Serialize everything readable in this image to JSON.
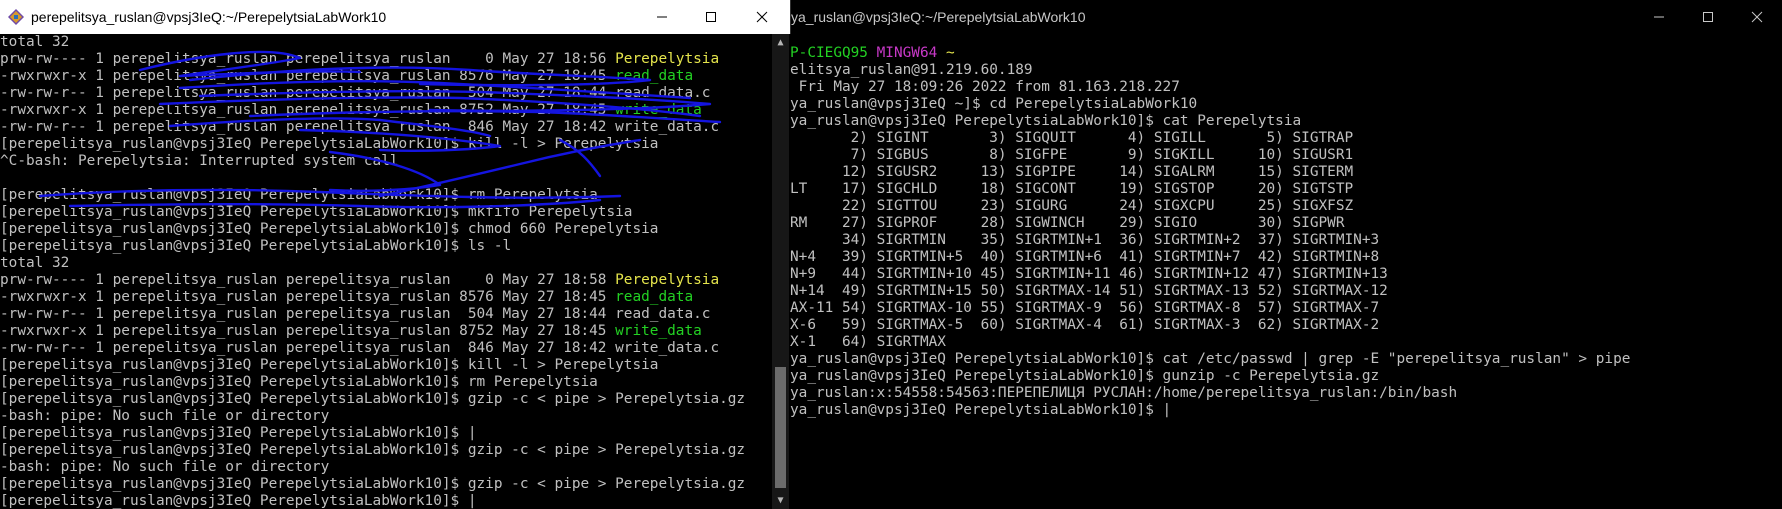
{
  "left_window": {
    "title": "perepelitsya_ruslan@vpsj3IeQ:~/PerepelytsiaLabWork10",
    "lines": [
      {
        "text": "total 32"
      },
      {
        "text": "prw-rw---- 1 perepelitsya_ruslan perepelitsya_ruslan    0 May 27 18:56 ",
        "highlight": "Perepelytsia",
        "color": "y"
      },
      {
        "text": "-rwxrwxr-x 1 perepelitsya_ruslan perepelitsya_ruslan 8576 May 27 18:45 ",
        "highlight": "read_data",
        "color": "g"
      },
      {
        "text": "-rw-rw-r-- 1 perepelitsya_ruslan perepelitsya_ruslan  504 May 27 18:44 read_data.c"
      },
      {
        "text": "-rwxrwxr-x 1 perepelitsya_ruslan perepelitsya_ruslan 8752 May 27 18:45 ",
        "highlight": "write_data",
        "color": "g"
      },
      {
        "text": "-rw-rw-r-- 1 perepelitsya_ruslan perepelitsya_ruslan  846 May 27 18:42 write_data.c"
      },
      {
        "text": "[perepelitsya_ruslan@vpsj3IeQ PerepelytsiaLabWork10]$ kill -l > Perepelytsia"
      },
      {
        "text": "^C-bash: Perepelytsia: Interrupted system call"
      },
      {
        "text": ""
      },
      {
        "text": "[perepelitsya_ruslan@vpsj3IeQ PerepelytsiaLabWork10]$ rm Perepelytsia"
      },
      {
        "text": "[perepelitsya_ruslan@vpsj3IeQ PerepelytsiaLabWork10]$ mkfifo Perepelytsia"
      },
      {
        "text": "[perepelitsya_ruslan@vpsj3IeQ PerepelytsiaLabWork10]$ chmod 660 Perepelytsia"
      },
      {
        "text": "[perepelitsya_ruslan@vpsj3IeQ PerepelytsiaLabWork10]$ ls -l"
      },
      {
        "text": "total 32"
      },
      {
        "text": "prw-rw---- 1 perepelitsya_ruslan perepelitsya_ruslan    0 May 27 18:58 ",
        "highlight": "Perepelytsia",
        "color": "y"
      },
      {
        "text": "-rwxrwxr-x 1 perepelitsya_ruslan perepelitsya_ruslan 8576 May 27 18:45 ",
        "highlight": "read_data",
        "color": "g"
      },
      {
        "text": "-rw-rw-r-- 1 perepelitsya_ruslan perepelitsya_ruslan  504 May 27 18:44 read_data.c"
      },
      {
        "text": "-rwxrwxr-x 1 perepelitsya_ruslan perepelitsya_ruslan 8752 May 27 18:45 ",
        "highlight": "write_data",
        "color": "g"
      },
      {
        "text": "-rw-rw-r-- 1 perepelitsya_ruslan perepelitsya_ruslan  846 May 27 18:42 write_data.c"
      },
      {
        "text": "[perepelitsya_ruslan@vpsj3IeQ PerepelytsiaLabWork10]$ kill -l > Perepelytsia"
      },
      {
        "text": "[perepelitsya_ruslan@vpsj3IeQ PerepelytsiaLabWork10]$ rm Perepelytsia"
      },
      {
        "text": "[perepelitsya_ruslan@vpsj3IeQ PerepelytsiaLabWork10]$ gzip -c < pipe > Perepelytsia.gz"
      },
      {
        "text": "-bash: pipe: No such file or directory"
      },
      {
        "text": "[perepelitsya_ruslan@vpsj3IeQ PerepelytsiaLabWork10]$ |"
      },
      {
        "text": "[perepelitsya_ruslan@vpsj3IeQ PerepelytsiaLabWork10]$ gzip -c < pipe > Perepelytsia.gz"
      },
      {
        "text": "-bash: pipe: No such file or directory"
      },
      {
        "text": "[perepelitsya_ruslan@vpsj3IeQ PerepelytsiaLabWork10]$ gzip -c < pipe > Perepelytsia.gz"
      },
      {
        "text": "[perepelitsya_ruslan@vpsj3IeQ PerepelytsiaLabWork10]$ |"
      }
    ]
  },
  "right_window": {
    "title": "ya_ruslan@vpsj3IeQ:~/PerepelytsiaLabWork10",
    "lines": [
      {
        "text": ""
      },
      {
        "text": "",
        "parts": [
          {
            "t": "P-CIEGQ95 ",
            "c": "g"
          },
          {
            "t": "MINGW64 ",
            "c": "p"
          },
          {
            "t": "~",
            "c": "y"
          }
        ]
      },
      {
        "text": "elitsya_ruslan@91.219.60.189"
      },
      {
        "text": " Fri May 27 18:09:26 2022 from 81.163.218.227"
      },
      {
        "text": "ya_ruslan@vpsj3IeQ ~]$ cd PerepelytsiaLabWork10"
      },
      {
        "text": "ya_ruslan@vpsj3IeQ PerepelytsiaLabWork10]$ cat Perepelytsia"
      },
      {
        "text": "       2) SIGINT       3) SIGQUIT      4) SIGILL       5) SIGTRAP"
      },
      {
        "text": "       7) SIGBUS       8) SIGFPE       9) SIGKILL     10) SIGUSR1"
      },
      {
        "text": "      12) SIGUSR2     13) SIGPIPE     14) SIGALRM     15) SIGTERM"
      },
      {
        "text": "LT    17) SIGCHLD     18) SIGCONT     19) SIGSTOP     20) SIGTSTP"
      },
      {
        "text": "      22) SIGTTOU     23) SIGURG      24) SIGXCPU     25) SIGXFSZ"
      },
      {
        "text": "RM    27) SIGPROF     28) SIGWINCH    29) SIGIO       30) SIGPWR"
      },
      {
        "text": "      34) SIGRTMIN    35) SIGRTMIN+1  36) SIGRTMIN+2  37) SIGRTMIN+3"
      },
      {
        "text": "N+4   39) SIGRTMIN+5  40) SIGRTMIN+6  41) SIGRTMIN+7  42) SIGRTMIN+8"
      },
      {
        "text": "N+9   44) SIGRTMIN+10 45) SIGRTMIN+11 46) SIGRTMIN+12 47) SIGRTMIN+13"
      },
      {
        "text": "N+14  49) SIGRTMIN+15 50) SIGRTMAX-14 51) SIGRTMAX-13 52) SIGRTMAX-12"
      },
      {
        "text": "AX-11 54) SIGRTMAX-10 55) SIGRTMAX-9  56) SIGRTMAX-8  57) SIGRTMAX-7"
      },
      {
        "text": "X-6   59) SIGRTMAX-5  60) SIGRTMAX-4  61) SIGRTMAX-3  62) SIGRTMAX-2"
      },
      {
        "text": "X-1   64) SIGRTMAX"
      },
      {
        "text": "ya_ruslan@vpsj3IeQ PerepelytsiaLabWork10]$ cat /etc/passwd | grep -E \"perepelitsya_ruslan\" > pipe"
      },
      {
        "text": "ya_ruslan@vpsj3IeQ PerepelytsiaLabWork10]$ gunzip -c Perepelytsia.gz"
      },
      {
        "text": "ya_ruslan:x:54558:54563:ПЕРЕПЕЛИЦЯ РУСЛАН:/home/perepelitsya_ruslan:/bin/bash"
      },
      {
        "text": "ya_ruslan@vpsj3IeQ PerepelytsiaLabWork10]$ |"
      }
    ]
  },
  "icons": [
    "terminal-app-icon",
    "minimize-icon",
    "maximize-icon",
    "close-icon"
  ],
  "colors": {
    "yellow": "#e5e54c",
    "green": "#23d123",
    "magenta": "#c839c8",
    "text": "#c0c0c0",
    "scribble": "#1414e0"
  }
}
